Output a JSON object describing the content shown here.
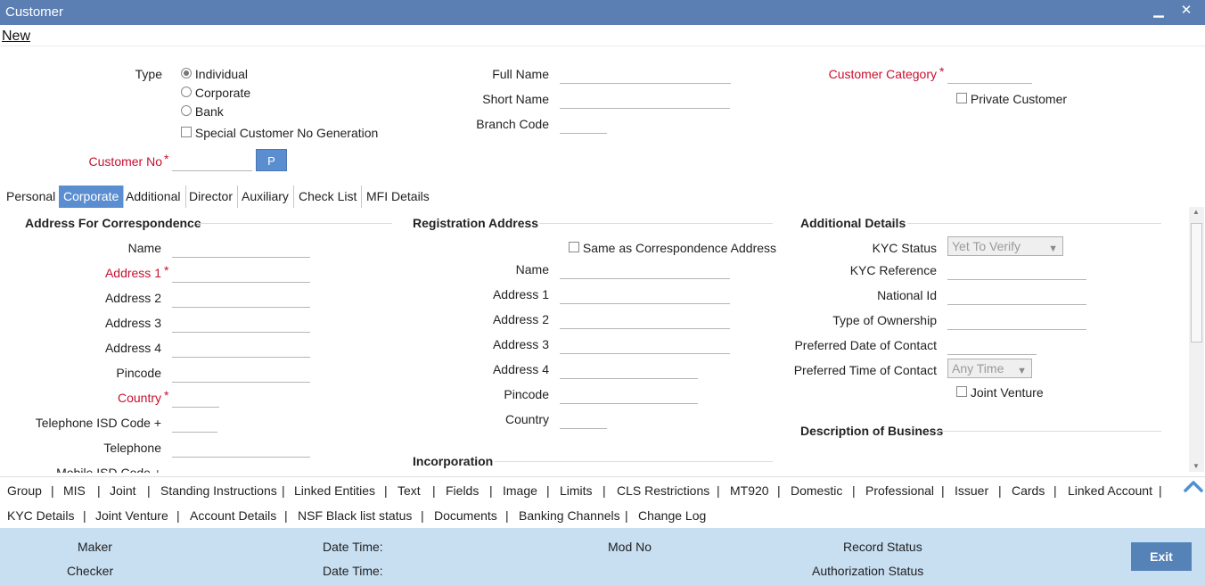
{
  "window": {
    "title": "Customer",
    "minimize_icon": "minimize-icon",
    "close_icon": "close-icon"
  },
  "toolbar": {
    "new_link": "New"
  },
  "header": {
    "type_label": "Type",
    "type_options": [
      "Individual",
      "Corporate",
      "Bank"
    ],
    "type_selected": "Individual",
    "special_gen_label": "Special Customer No Generation",
    "customer_no_label": "Customer No",
    "p_button": "P",
    "full_name_label": "Full Name",
    "short_name_label": "Short Name",
    "branch_code_label": "Branch Code",
    "category_label": "Customer Category",
    "private_customer_label": "Private Customer"
  },
  "tabs": [
    "Personal",
    "Corporate",
    "Additional",
    "Director",
    "Auxiliary",
    "Check List",
    "MFI Details"
  ],
  "active_tab": "Corporate",
  "correspondence": {
    "heading": "Address For Correspondence",
    "fields": [
      "Name",
      "Address 1",
      "Address 2",
      "Address 3",
      "Address 4",
      "Pincode",
      "Country",
      "Telephone ISD Code +",
      "Telephone",
      "Mobile ISD Code +"
    ]
  },
  "registration": {
    "heading": "Registration Address",
    "same_as_label": "Same as Correspondence Address",
    "fields": [
      "Name",
      "Address 1",
      "Address 2",
      "Address 3",
      "Address 4",
      "Pincode",
      "Country"
    ],
    "incorporation_heading": "Incorporation"
  },
  "additional": {
    "heading": "Additional Details",
    "kyc_status_label": "KYC Status",
    "kyc_status_value": "Yet To Verify",
    "kyc_reference_label": "KYC Reference",
    "national_id_label": "National Id",
    "ownership_label": "Type of Ownership",
    "pref_date_label": "Preferred Date of Contact",
    "pref_time_label": "Preferred Time of Contact",
    "pref_time_value": "Any Time",
    "joint_venture_label": "Joint Venture",
    "description_heading": "Description of Business"
  },
  "links_row1": [
    "Group",
    "MIS",
    "Joint",
    "Standing Instructions",
    "Linked Entities",
    "Text",
    "Fields",
    "Image",
    "Limits",
    "CLS Restrictions",
    "MT920",
    "Domestic",
    "Professional",
    "Issuer",
    "Cards",
    "Linked Account"
  ],
  "links_row2": [
    "KYC Details",
    "Joint Venture",
    "Account Details",
    "NSF Black list status",
    "Documents",
    "Banking Channels",
    "Change Log"
  ],
  "footer": {
    "maker": "Maker",
    "checker": "Checker",
    "date_time": "Date Time:",
    "mod_no": "Mod No",
    "record_status": "Record Status",
    "auth_status": "Authorization Status",
    "exit": "Exit"
  },
  "colors": {
    "titlebar": "#5b7fb2",
    "accent": "#5b8ed0",
    "required": "#c8102e",
    "footer": "#c8dff2"
  }
}
